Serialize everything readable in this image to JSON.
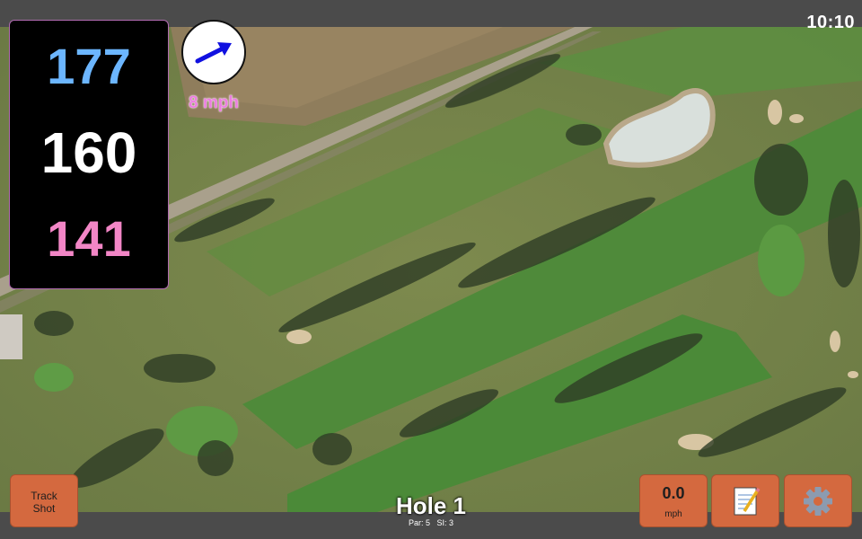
{
  "status_bar": {
    "time": "10:10"
  },
  "yardage": {
    "back": "177",
    "middle": "160",
    "front": "141"
  },
  "wind": {
    "speed_label": "8 mph",
    "direction_icon": "arrow-east-northeast"
  },
  "hole": {
    "title": "Hole 1",
    "par": "Par: 5",
    "stroke_index": "SI: 3"
  },
  "buttons": {
    "track_shot": "Track\nShot",
    "speed_value": "0.0",
    "speed_unit": "mph",
    "notes_icon": "notepad-icon",
    "settings_icon": "gear-icon"
  },
  "colors": {
    "back": "#6cb6ff",
    "middle": "#ffffff",
    "front": "#f286c6",
    "button": "#d4693f",
    "wind_text": "#ec7ee0"
  }
}
